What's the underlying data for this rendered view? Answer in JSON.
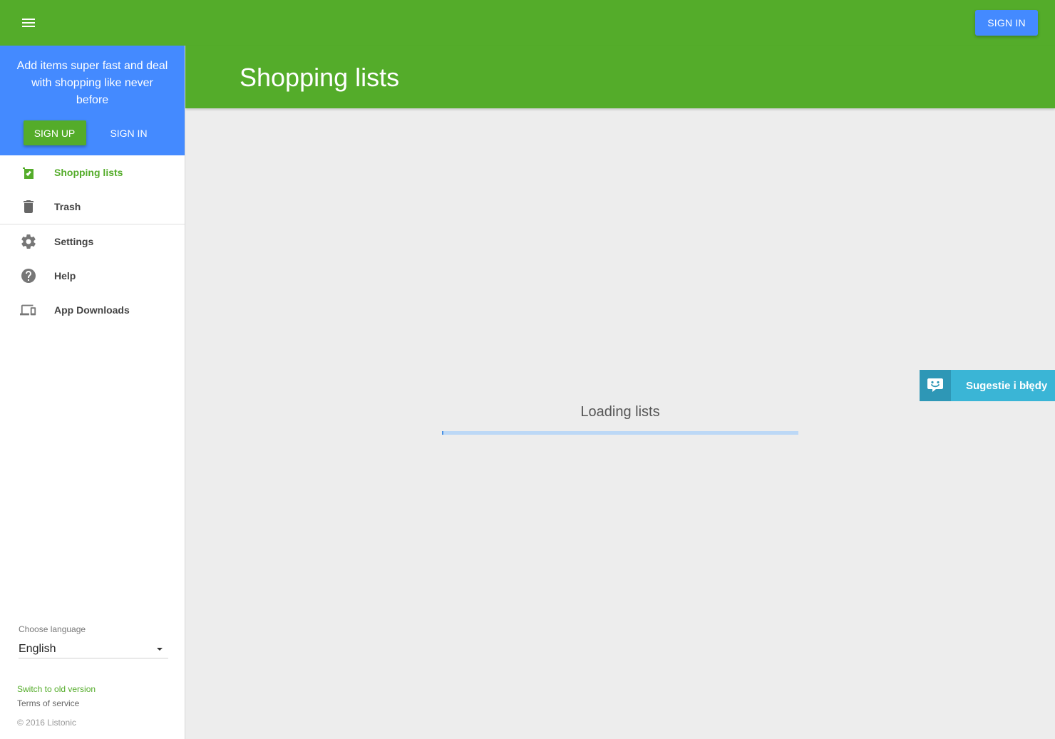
{
  "topbar": {
    "menu_icon": "menu-icon",
    "signin_label": "SIGN IN"
  },
  "main": {
    "title": "Shopping lists",
    "loading_text": "Loading lists",
    "progress_fraction": 0.004
  },
  "sidebar": {
    "promo": {
      "text": "Add items super fast and deal with shopping like never before",
      "signup_label": "SIGN UP",
      "signin_label": "SIGN IN"
    },
    "items": [
      {
        "label": "Shopping lists",
        "icon": "list-check-icon",
        "active": true
      },
      {
        "label": "Trash",
        "icon": "trash-icon",
        "active": false
      },
      {
        "label": "Settings",
        "icon": "gear-icon",
        "active": false
      },
      {
        "label": "Help",
        "icon": "help-icon",
        "active": false
      },
      {
        "label": "App Downloads",
        "icon": "devices-icon",
        "active": false
      }
    ],
    "language": {
      "label": "Choose language",
      "selected": "English"
    },
    "footer": {
      "old_version": "Switch to old version",
      "terms": "Terms of service",
      "copyright": "© 2016 Listonic"
    }
  },
  "feedback": {
    "label": "Sugestie i błędy",
    "icon": "feedback-face-icon"
  },
  "colors": {
    "brand_green": "#54ac2a",
    "accent_blue": "#448aff",
    "feedback_cyan": "#3ab5d6"
  }
}
